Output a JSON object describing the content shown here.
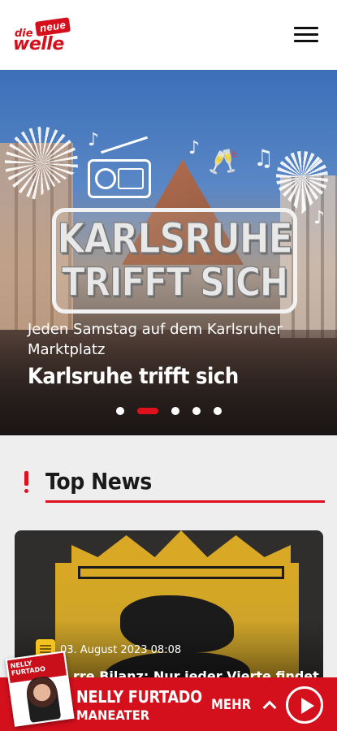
{
  "header": {
    "logo": {
      "top_word": "die",
      "badge": "neue",
      "main_word": "welle"
    },
    "menu_icon": "hamburger-menu-icon"
  },
  "hero": {
    "image_text_line1": "KARLSRUHE",
    "image_text_line2": "TRIFFT SICH",
    "subtitle": "Jeden Samstag auf dem Karlsruher Marktplatz",
    "title": "Karlsruhe trifft sich",
    "slides_total": 5,
    "active_slide": 2
  },
  "top_news": {
    "heading": "Top News",
    "article": {
      "date": "03. August 2023 08:08",
      "headline": "…rre Bilanz: Nur jeder Vierte findet"
    }
  },
  "player": {
    "cover_text": "NELLY FURTADO",
    "artist": "NELLY FURTADO",
    "song": "MANEATER",
    "more_label": "MEHR",
    "icons": {
      "more": "chevron-up-icon",
      "play": "play-icon"
    }
  },
  "colors": {
    "brand_red": "#d3101c",
    "accent_yellow": "#f4c21e"
  }
}
